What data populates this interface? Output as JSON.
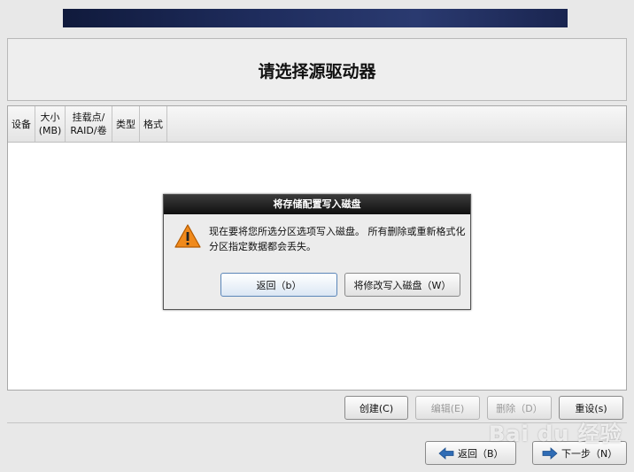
{
  "page_title": "请选择源驱动器",
  "table": {
    "columns": [
      "设备",
      "大小\n(MB)",
      "挂载点/\nRAID/卷",
      "类型",
      "格式"
    ]
  },
  "dialog": {
    "title": "将存储配置写入磁盘",
    "message": "现在要将您所选分区选项写入磁盘。 所有删除或重新格式化分区指定数据都会丢失。",
    "back_label": "返回（b）",
    "write_label": "将修改写入磁盘（W）",
    "icon": "warning-icon"
  },
  "actions": {
    "create": "创建(C)",
    "edit": "编辑(E)",
    "delete": "删除（D）",
    "reset": "重设(s)"
  },
  "nav": {
    "back": "返回（B）",
    "next": "下一步（N）"
  },
  "watermark": "Bai du 经验",
  "colors": {
    "banner": "#1a2550",
    "dialog_titlebar": "#1a1a1a",
    "warning": "#f08a1c"
  }
}
